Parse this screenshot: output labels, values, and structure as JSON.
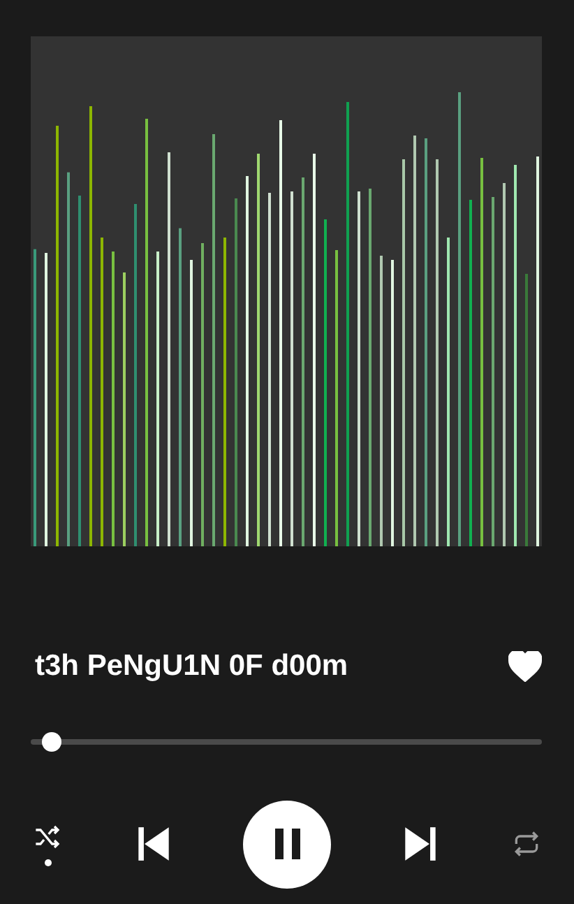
{
  "track": {
    "title": "t3h PeNgU1N 0F d00m",
    "liked": true
  },
  "progress": {
    "level": 0.02
  },
  "controls": {
    "shuffle": true,
    "playing": true,
    "repeat": false
  }
}
